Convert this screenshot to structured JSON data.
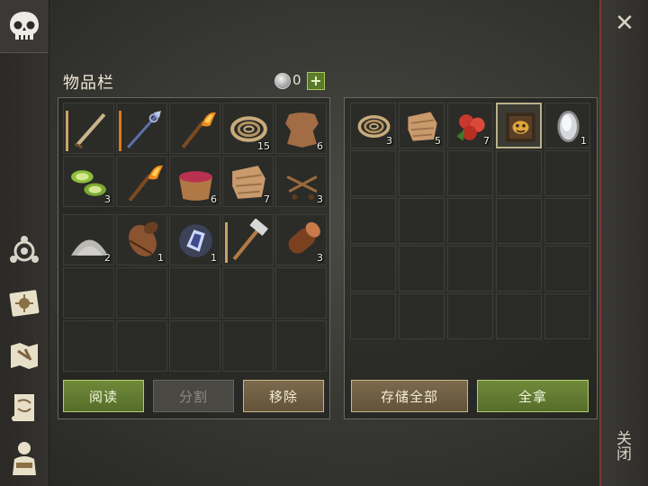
{
  "inventory": {
    "title": "物品栏",
    "currency_count": "0",
    "currency_add": "+",
    "equipped_slots": [
      {
        "icon": "sword-icon",
        "count": "",
        "bar": "#c7a36b"
      },
      {
        "icon": "spear-icon",
        "count": "",
        "bar": "#d97a1e"
      },
      {
        "icon": "torch-icon",
        "count": "",
        "bar": ""
      },
      {
        "icon": "rope-icon",
        "count": "15",
        "bar": ""
      },
      {
        "icon": "leather-icon",
        "count": "6",
        "bar": ""
      },
      {
        "icon": "cucumber-icon",
        "count": "3",
        "bar": ""
      },
      {
        "icon": "torch-icon",
        "count": "",
        "bar": ""
      },
      {
        "icon": "berry-bowl-icon",
        "count": "6",
        "bar": ""
      },
      {
        "icon": "cloth-icon",
        "count": "7",
        "bar": ""
      },
      {
        "icon": "nails-icon",
        "count": "3",
        "bar": ""
      }
    ],
    "bag_slots": [
      {
        "icon": "sand-pile-icon",
        "count": "2",
        "bar": ""
      },
      {
        "icon": "barrel-icon",
        "count": "1",
        "bar": ""
      },
      {
        "icon": "crystal-icon",
        "count": "1",
        "bar": ""
      },
      {
        "icon": "hammer-icon",
        "count": "",
        "bar": "#c7a36b"
      },
      {
        "icon": "log-icon",
        "count": "3",
        "bar": ""
      }
    ],
    "buttons": {
      "read": "阅读",
      "split": "分割",
      "remove": "移除"
    }
  },
  "storage": {
    "slots": [
      {
        "icon": "rope-icon",
        "count": "3"
      },
      {
        "icon": "cloth-icon",
        "count": "5"
      },
      {
        "icon": "apple-icon",
        "count": "7"
      },
      {
        "icon": "book-icon",
        "count": ""
      },
      {
        "icon": "mirror-icon",
        "count": "1"
      }
    ],
    "buttons": {
      "store_all": "存储全部",
      "take_all": "全拿"
    }
  },
  "close": {
    "label": "关闭",
    "x": "✕"
  },
  "colors": {
    "accent_green": "#6f8a3a",
    "accent_brown": "#7c6a4c",
    "close_border": "#7a3a2a"
  }
}
